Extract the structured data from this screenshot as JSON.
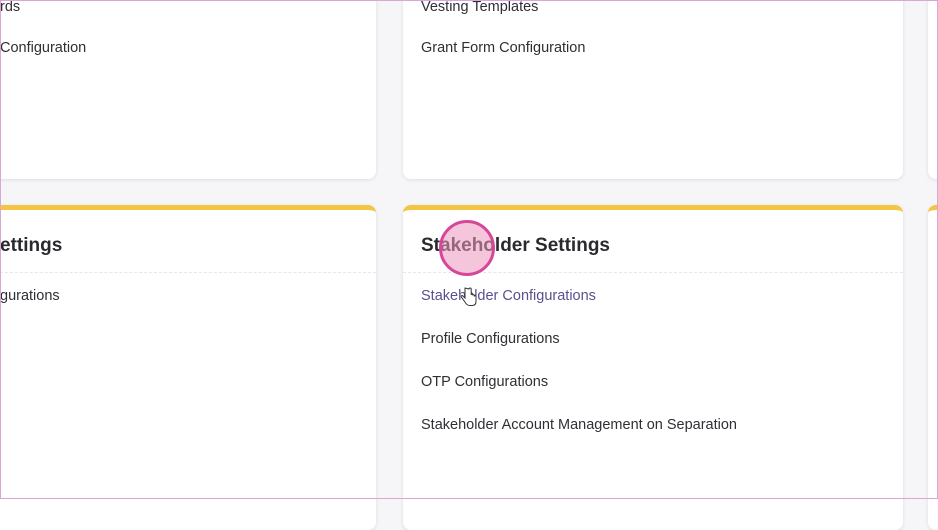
{
  "top_left_card": {
    "links": [
      "rds",
      "Configuration"
    ]
  },
  "top_right_card": {
    "links": [
      "Vesting Templates",
      "Grant Form Configuration"
    ]
  },
  "bottom_left_card": {
    "title": "ettings",
    "links": [
      "gurations"
    ]
  },
  "bottom_right_card": {
    "title": "Stakeholder Settings",
    "links": [
      "Stakeholder Configurations",
      "Profile Configurations",
      "OTP Configurations",
      "Stakeholder Account Management on Separation"
    ]
  },
  "colors": {
    "accent": "#f4c542",
    "hover_link": "#5b4f8e",
    "click_indicator": "#d6479a"
  }
}
